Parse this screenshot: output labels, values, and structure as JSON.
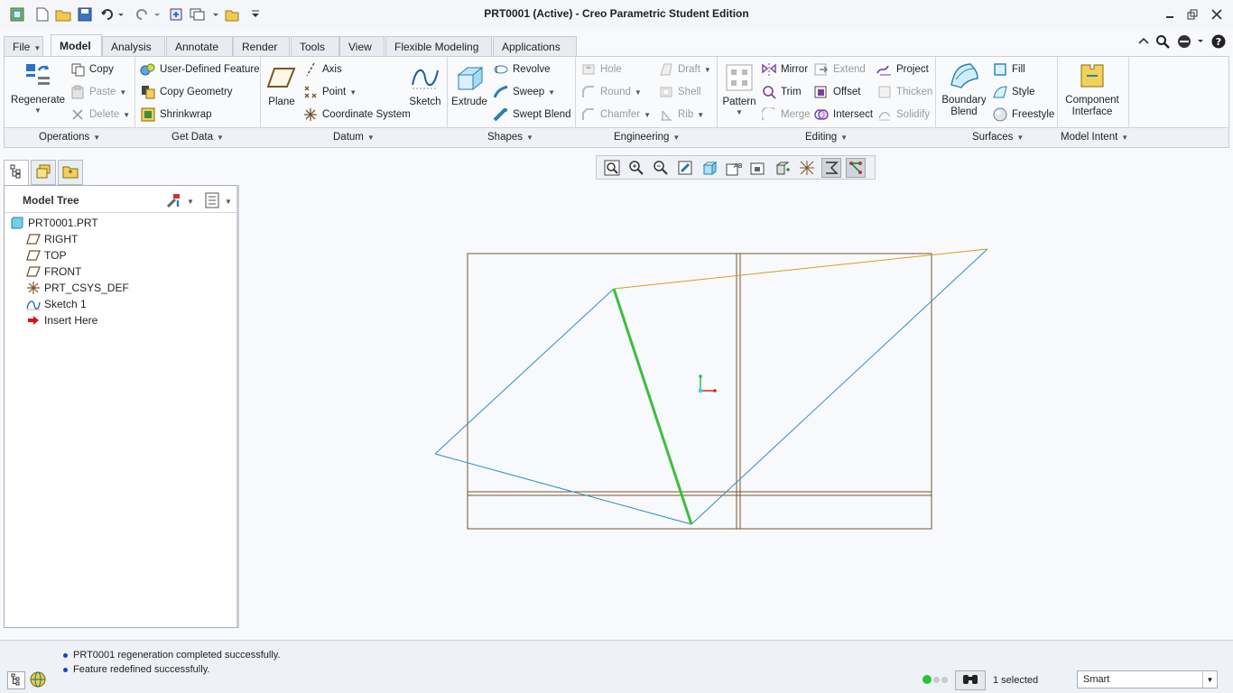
{
  "window": {
    "title": "PRT0001 (Active) - Creo Parametric Student Edition",
    "controls": [
      "minimize-icon",
      "restore-icon",
      "close-icon"
    ]
  },
  "quick_access": [
    "app-logo-icon",
    "new-icon",
    "open-icon",
    "save-icon",
    "undo-icon",
    "redo-icon",
    "regenerate-icon",
    "windows-icon",
    "close-window-icon",
    "customize-icon"
  ],
  "tabs": [
    {
      "label": "File",
      "active": false
    },
    {
      "label": "Model",
      "active": true
    },
    {
      "label": "Analysis",
      "active": false
    },
    {
      "label": "Annotate",
      "active": false
    },
    {
      "label": "Render",
      "active": false
    },
    {
      "label": "Tools",
      "active": false
    },
    {
      "label": "View",
      "active": false
    },
    {
      "label": "Flexible Modeling",
      "active": false
    },
    {
      "label": "Applications",
      "active": false
    }
  ],
  "ribbon": {
    "operations": {
      "regenerate": "Regenerate",
      "copy": "Copy",
      "paste": "Paste",
      "delete": "Delete"
    },
    "get_data": {
      "udf": "User-Defined Feature",
      "copy_geometry": "Copy Geometry",
      "shrinkwrap": "Shrinkwrap"
    },
    "datum": {
      "plane": "Plane",
      "axis": "Axis",
      "point": "Point",
      "csys": "Coordinate System",
      "sketch": "Sketch"
    },
    "shapes": {
      "extrude": "Extrude",
      "revolve": "Revolve",
      "sweep": "Sweep",
      "swept_blend": "Swept Blend"
    },
    "engineering": {
      "hole": "Hole",
      "round": "Round",
      "chamfer": "Chamfer",
      "draft": "Draft",
      "shell": "Shell",
      "rib": "Rib"
    },
    "editing": {
      "pattern": "Pattern",
      "mirror": "Mirror",
      "trim": "Trim",
      "merge": "Merge",
      "extend": "Extend",
      "offset": "Offset",
      "intersect": "Intersect",
      "project": "Project",
      "thicken": "Thicken",
      "solidify": "Solidify"
    },
    "surfaces": {
      "boundary_blend_1": "Boundary",
      "boundary_blend_2": "Blend",
      "fill": "Fill",
      "style": "Style",
      "freestyle": "Freestyle"
    },
    "model_intent": {
      "component_interface_1": "Component",
      "component_interface_2": "Interface"
    },
    "groups": [
      "Operations",
      "Get Data",
      "Datum",
      "Shapes",
      "Engineering",
      "Editing",
      "Surfaces",
      "Model Intent"
    ]
  },
  "model_tree": {
    "title": "Model Tree",
    "items": [
      {
        "label": "PRT0001.PRT",
        "icon": "part-icon"
      },
      {
        "label": "RIGHT",
        "icon": "datum-plane-icon"
      },
      {
        "label": "TOP",
        "icon": "datum-plane-icon"
      },
      {
        "label": "FRONT",
        "icon": "datum-plane-icon"
      },
      {
        "label": "PRT_CSYS_DEF",
        "icon": "csys-icon"
      },
      {
        "label": "Sketch 1",
        "icon": "sketch-icon"
      },
      {
        "label": "Insert Here",
        "icon": "insert-arrow-icon"
      }
    ]
  },
  "view_toolbar": [
    "refit-icon",
    "zoom-in-icon",
    "zoom-out-icon",
    "repaint-icon",
    "display-style-icon",
    "saved-orientations-icon",
    "view-manager-icon",
    "perspective-icon",
    "spin-center-icon",
    "datum-display-icon",
    "annotation-display-icon",
    "sketcher-display-icon"
  ],
  "messages": [
    "PRT0001 regeneration completed successfully.",
    "Feature redefined successfully."
  ],
  "status": {
    "selected": "1 selected",
    "filter": "Smart"
  },
  "colors": {
    "datum_plane": "#7a5528",
    "sketch_line": "#2e8fbf",
    "selected_edge": "#3cbf3c",
    "highlight_edge": "#d4a020"
  }
}
